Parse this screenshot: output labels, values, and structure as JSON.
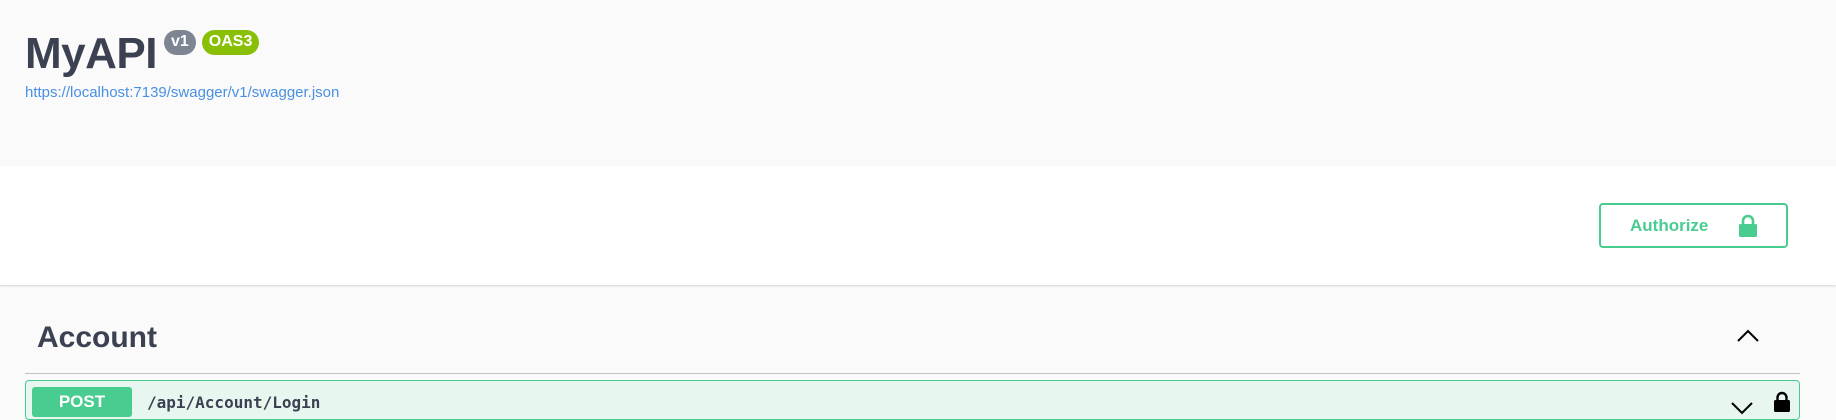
{
  "info": {
    "title": "MyAPI",
    "version_badge": "v1",
    "oas_badge": "OAS3",
    "spec_url": "https://localhost:7139/swagger/v1/swagger.json"
  },
  "scheme": {
    "authorize_label": "Authorize"
  },
  "sections": [
    {
      "tag": "Account",
      "operations": [
        {
          "method": "POST",
          "path": "/api/Account/Login"
        }
      ]
    }
  ],
  "colors": {
    "post_accent": "#49cc90",
    "link": "#4990e2",
    "version_badge": "#7d8492",
    "oas_badge": "#89bf04",
    "text": "#3b4151"
  },
  "icons": {
    "authorize": "lock-icon",
    "section_toggle": "chevron-up-icon",
    "operation_toggle": "chevron-down-icon",
    "operation_auth": "lock-icon"
  }
}
